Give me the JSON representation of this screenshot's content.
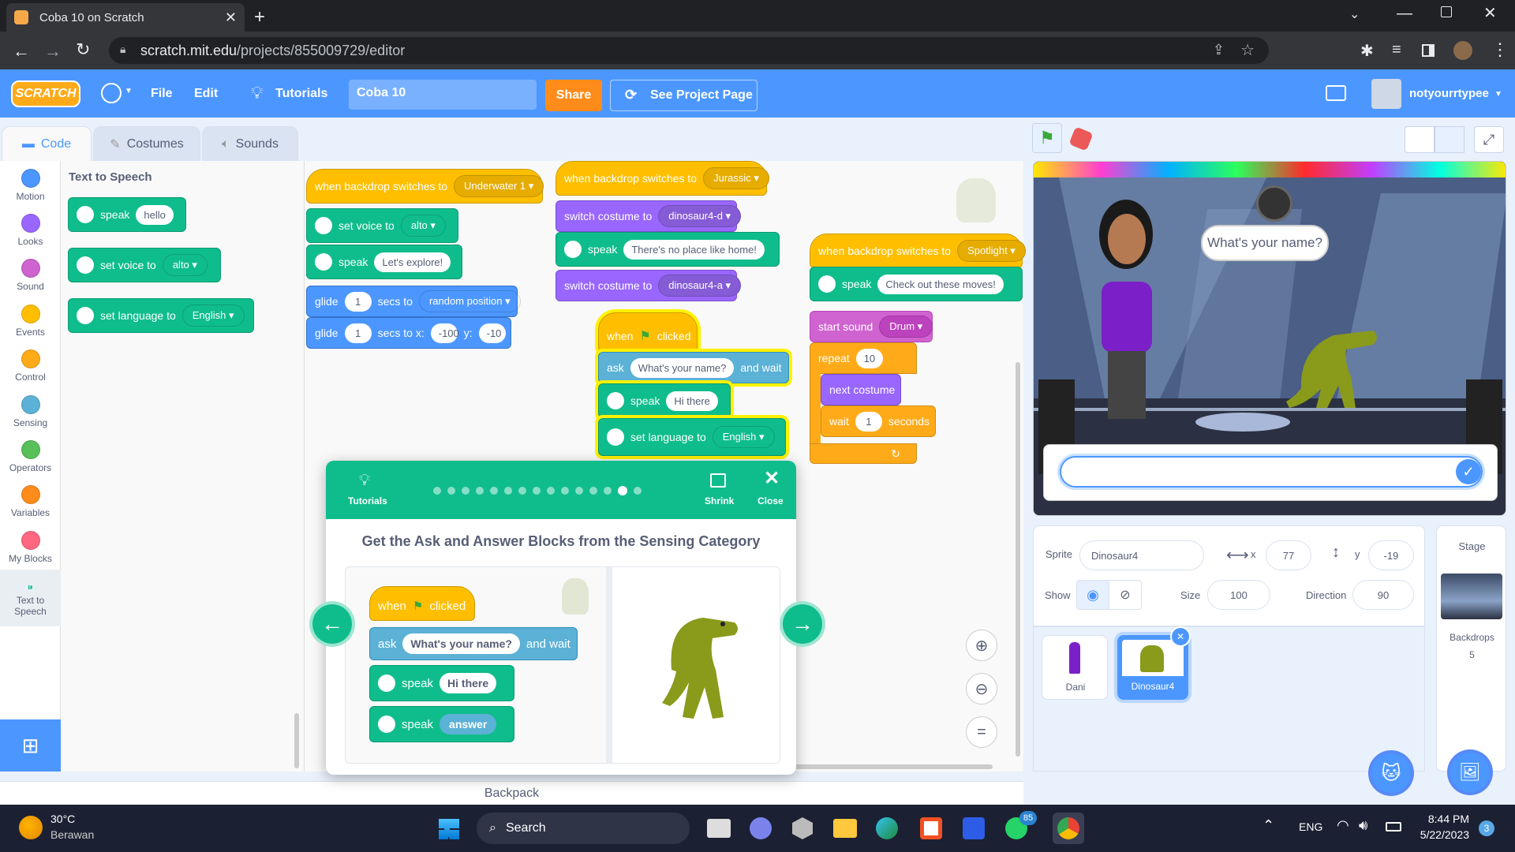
{
  "browser": {
    "tab_title": "Coba 10 on Scratch",
    "url_host": "scratch.mit.edu",
    "url_path": "/projects/855009729/editor"
  },
  "menubar": {
    "logo": "SCRATCH",
    "file": "File",
    "edit": "Edit",
    "tutorials": "Tutorials",
    "project_title": "Coba 10",
    "share": "Share",
    "see_project": "See Project Page",
    "username": "notyourrtypee"
  },
  "tabs": {
    "code": "Code",
    "costumes": "Costumes",
    "sounds": "Sounds"
  },
  "categories": [
    {
      "label": "Motion",
      "color": "#4c97ff"
    },
    {
      "label": "Looks",
      "color": "#9966ff"
    },
    {
      "label": "Sound",
      "color": "#cf63cf"
    },
    {
      "label": "Events",
      "color": "#ffbf00"
    },
    {
      "label": "Control",
      "color": "#ffab19"
    },
    {
      "label": "Sensing",
      "color": "#5cb1d6"
    },
    {
      "label": "Operators",
      "color": "#59c059"
    },
    {
      "label": "Variables",
      "color": "#ff8c1a"
    },
    {
      "label": "My Blocks",
      "color": "#ff6680"
    },
    {
      "label": "Text to Speech",
      "color": "#0fbd8c"
    }
  ],
  "palette": {
    "heading": "Text to Speech",
    "speak": "speak",
    "speak_val": "hello",
    "set_voice": "set voice to",
    "voice_val": "alto",
    "set_lang": "set language to",
    "lang_val": "English"
  },
  "scripts": {
    "s1_hat": "when backdrop switches to",
    "s1_hat_val": "Underwater 1",
    "s1_voice": "set voice to",
    "s1_voice_val": "alto",
    "s1_speak": "speak",
    "s1_speak_val": "Let's explore!",
    "s1_glide": "glide",
    "s1_glide_n": "1",
    "s1_glide_secs": "secs to",
    "s1_glide_dest": "random position",
    "s1_glide2": "glide",
    "s1_glide2_n": "1",
    "s1_glide2_secs": "secs to x:",
    "s1_glide2_x": "-100",
    "s1_glide2_y_lbl": "y:",
    "s1_glide2_y": "-10",
    "s2_hat": "when backdrop switches to",
    "s2_hat_val": "Jurassic",
    "s2_costume": "switch costume to",
    "s2_costume_val": "dinosaur4-d",
    "s2_speak": "speak",
    "s2_speak_val": "There's no place like home!",
    "s2_costume2": "switch costume to",
    "s2_costume2_val": "dinosaur4-a",
    "s3_when": "when",
    "s3_clicked": "clicked",
    "s3_ask": "ask",
    "s3_ask_val": "What's your name?",
    "s3_wait": "and wait",
    "s3_speak": "speak",
    "s3_speak_val": "Hi there",
    "s3_lang": "set language to",
    "s3_lang_val": "English",
    "s4_hat": "when backdrop switches to",
    "s4_hat_val": "Spotlight",
    "s4_speak": "speak",
    "s4_speak_val": "Check out these moves!",
    "s4_sound": "start sound",
    "s4_sound_val": "Drum",
    "s4_repeat": "repeat",
    "s4_repeat_val": "10",
    "s4_next": "next costume",
    "s4_wait": "wait",
    "s4_wait_val": "1",
    "s4_seconds": "seconds"
  },
  "tutorial": {
    "label": "Tutorials",
    "shrink": "Shrink",
    "close": "Close",
    "title": "Get the Ask and Answer Blocks from the Sensing Category",
    "dots_total": 15,
    "dot_active_index": 13,
    "demo_when": "when",
    "demo_clicked": "clicked",
    "demo_ask": "ask",
    "demo_ask_val": "What's your name?",
    "demo_wait": "and wait",
    "demo_speak": "speak",
    "demo_speak_val": "Hi there",
    "demo_speak2": "speak",
    "demo_speak2_val": "answer"
  },
  "stage": {
    "speech": "What's your name?",
    "answer_value": ""
  },
  "sprite": {
    "label": "Sprite",
    "name": "Dinosaur4",
    "x_label": "x",
    "x": "77",
    "y_label": "y",
    "y": "-19",
    "show": "Show",
    "size_label": "Size",
    "size": "100",
    "dir_label": "Direction",
    "direction": "90"
  },
  "sprites": [
    {
      "name": "Dani",
      "selected": false
    },
    {
      "name": "Dinosaur4",
      "selected": true
    }
  ],
  "stage_panel": {
    "title": "Stage",
    "backdrops_label": "Backdrops",
    "backdrops_count": "5"
  },
  "backpack": "Backpack",
  "taskbar": {
    "temp": "30°C",
    "weather": "Berawan",
    "search": "Search",
    "lang": "ENG",
    "time": "8:44 PM",
    "date": "5/22/2023",
    "whatsapp_badge": "85",
    "notif_count": "3"
  }
}
